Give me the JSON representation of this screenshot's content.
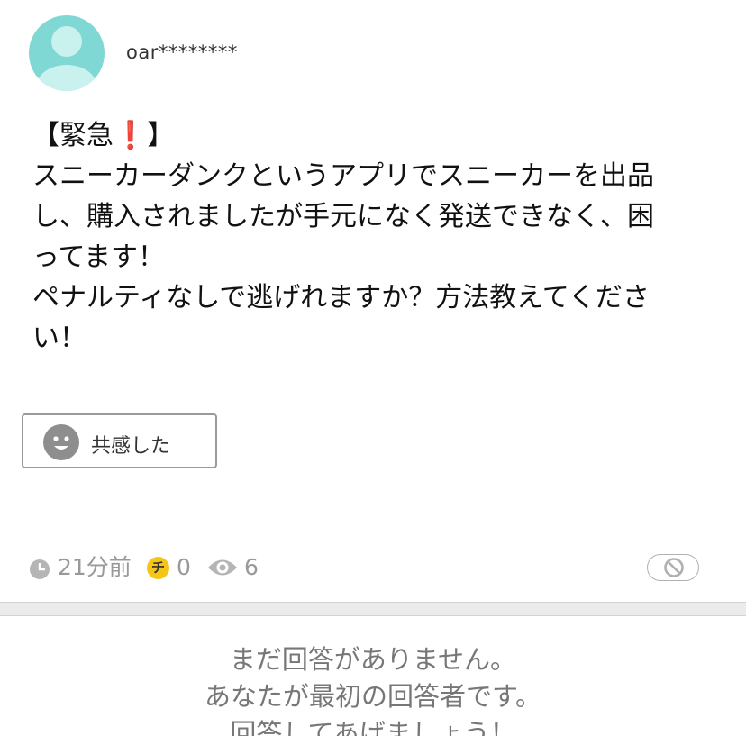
{
  "user": {
    "name": "oar********"
  },
  "question": {
    "line1_open": "【緊急",
    "line1_mark": "❗️",
    "line1_close": "】",
    "line2": "スニーカーダンクというアプリでスニーカーを出品",
    "line3": "し、購入されましたが手元になく発送できなく、困",
    "line4": "ってます！",
    "line5": "ペナルティなしで逃げれますか？方法教えてくださ",
    "line6": "い！"
  },
  "empathy": {
    "label": "共感した",
    "icon": "smiley-face-icon"
  },
  "meta": {
    "time_ago": "21分前",
    "coin_glyph": "チ",
    "coins": "0",
    "views": "6",
    "icons": [
      "clock-icon",
      "coin-icon",
      "eye-icon",
      "report-icon"
    ]
  },
  "answers": {
    "empty_line1": "まだ回答がありません。",
    "empty_line2": "あなたが最初の回答者です。",
    "empty_line3": "回答してあげましょう！"
  },
  "colors": {
    "avatar_bg": "#7fd8d4",
    "avatar_fg": "#c9f1ee",
    "coin": "#f5c518",
    "meta_text": "#999999",
    "exclaim": "#e0201c"
  }
}
